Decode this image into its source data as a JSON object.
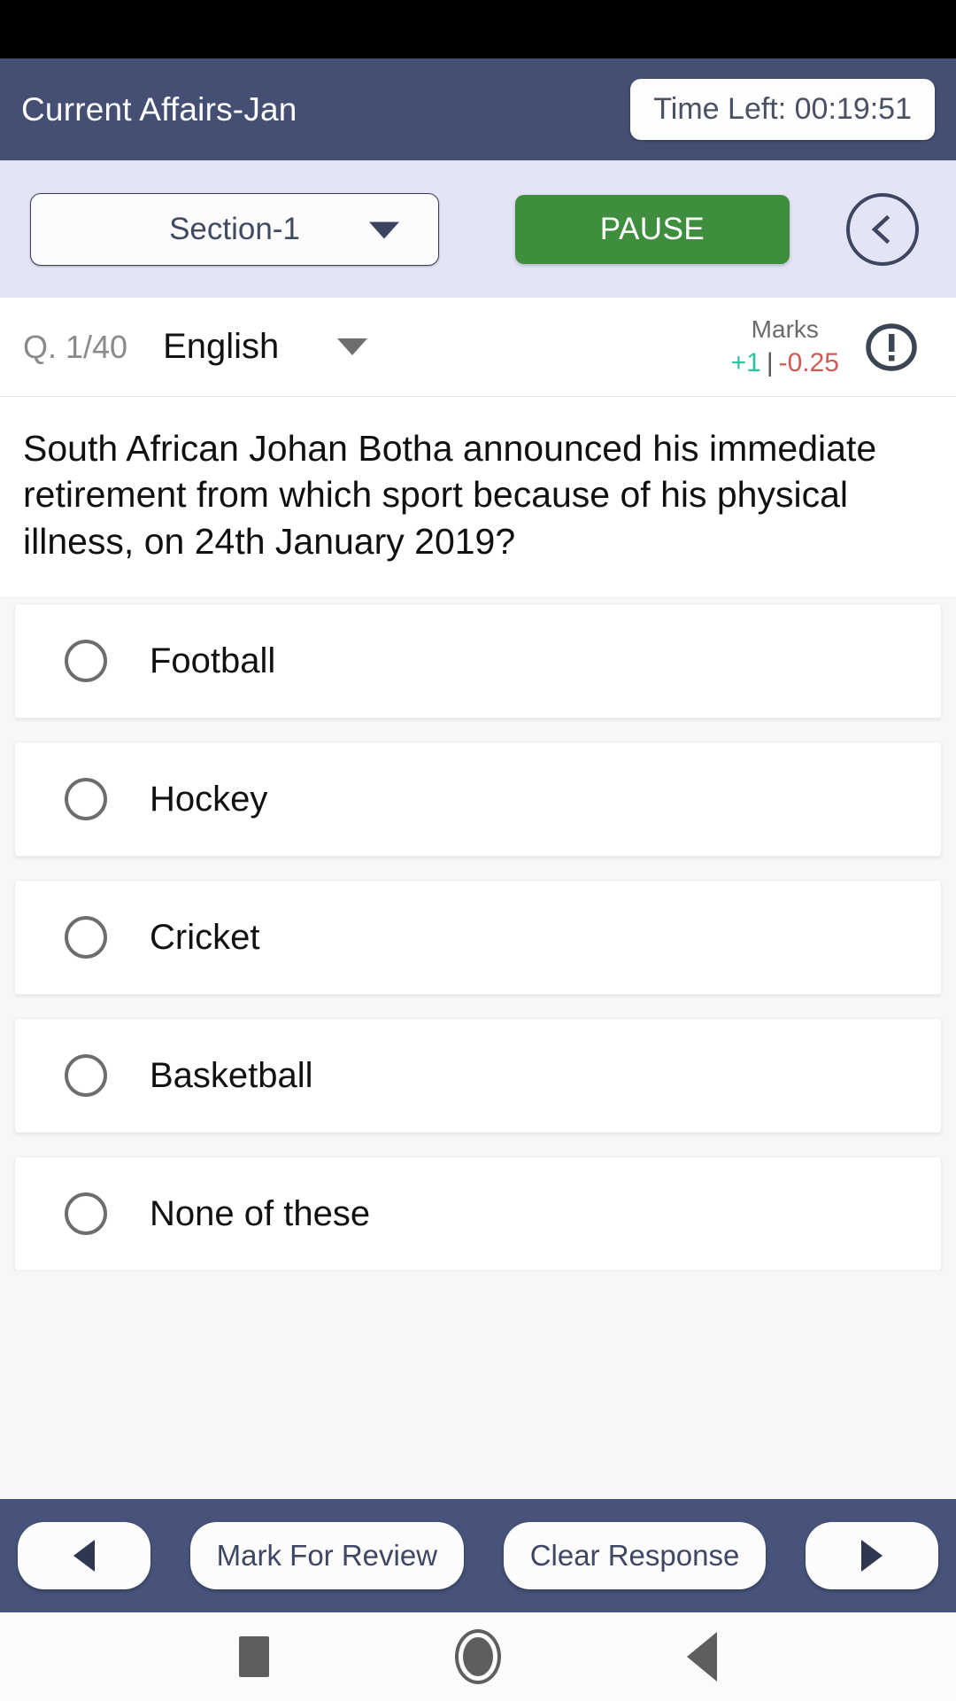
{
  "colors": {
    "header_bg": "#454f73",
    "control_band_bg": "#e3e4f5",
    "pause_green": "#3e8e3e",
    "action_bar_bg": "#47537a",
    "marks_positive": "#2ec2a0",
    "marks_negative": "#d05a55",
    "page_bg": "#f7f7f8"
  },
  "header": {
    "title": "Current Affairs-Jan",
    "timer": "Time Left: 00:19:51"
  },
  "controls": {
    "section": "Section-1",
    "pause_label": "PAUSE",
    "back_icon": "chevron-left-circle-icon"
  },
  "question_meta": {
    "question_counter": "Q. 1/40",
    "language": "English",
    "marks_title": "Marks",
    "marks_positive": "+1",
    "marks_separator": "|",
    "marks_negative": "-0.25",
    "info_icon": "exclamation-circle-icon"
  },
  "question": {
    "text": "South African Johan Botha announced his immediate retirement from which sport because of his physical illness, on 24th January 2019?",
    "options": [
      {
        "label": "Football",
        "selected": false
      },
      {
        "label": "Hockey",
        "selected": false
      },
      {
        "label": "Cricket",
        "selected": false
      },
      {
        "label": "Basketball",
        "selected": false
      },
      {
        "label": "None of these",
        "selected": false
      }
    ]
  },
  "actions": {
    "prev_icon": "arrow-left-icon",
    "mark_for_review": "Mark For Review",
    "clear_response": "Clear Response",
    "next_icon": "arrow-right-icon"
  },
  "android_nav": {
    "recents": "square-icon",
    "home": "circle-icon",
    "back": "triangle-back-icon"
  }
}
